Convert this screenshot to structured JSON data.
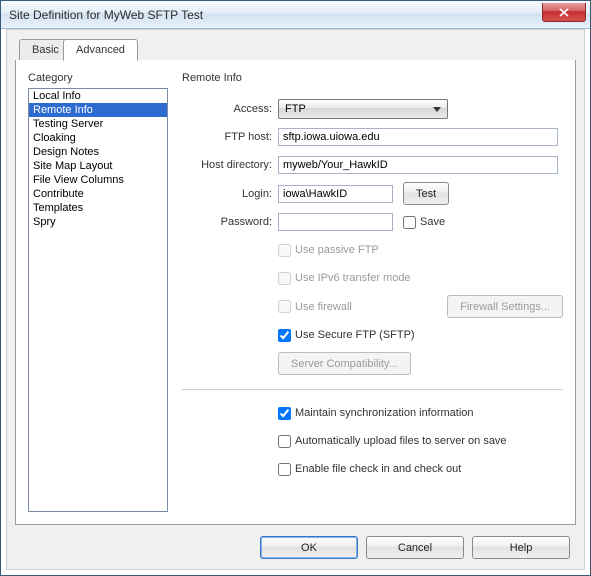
{
  "window": {
    "title": "Site Definition for MyWeb SFTP Test"
  },
  "tabs": {
    "basic": "Basic",
    "advanced": "Advanced"
  },
  "left": {
    "label": "Category",
    "items": [
      "Local Info",
      "Remote Info",
      "Testing Server",
      "Cloaking",
      "Design Notes",
      "Site Map Layout",
      "File View Columns",
      "Contribute",
      "Templates",
      "Spry"
    ],
    "selected_index": 1
  },
  "form": {
    "section_title": "Remote Info",
    "labels": {
      "access": "Access:",
      "ftp_host": "FTP host:",
      "host_dir": "Host directory:",
      "login": "Login:",
      "password": "Password:"
    },
    "values": {
      "access": "FTP",
      "ftp_host": "sftp.iowa.uiowa.edu",
      "host_dir": "myweb/Your_HawkID",
      "login": "iowa\\HawkID",
      "password": ""
    },
    "buttons": {
      "test": "Test",
      "firewall": "Firewall Settings...",
      "compat": "Server Compatibility..."
    },
    "checks": {
      "save": "Save",
      "passive": "Use passive FTP",
      "ipv6": "Use IPv6 transfer mode",
      "firewall": "Use firewall",
      "sftp": "Use Secure FTP (SFTP)",
      "sync": "Maintain synchronization information",
      "auto_upload": "Automatically upload files to server on save",
      "checkinout": "Enable file check in and check out"
    }
  },
  "footer": {
    "ok": "OK",
    "cancel": "Cancel",
    "help": "Help"
  }
}
